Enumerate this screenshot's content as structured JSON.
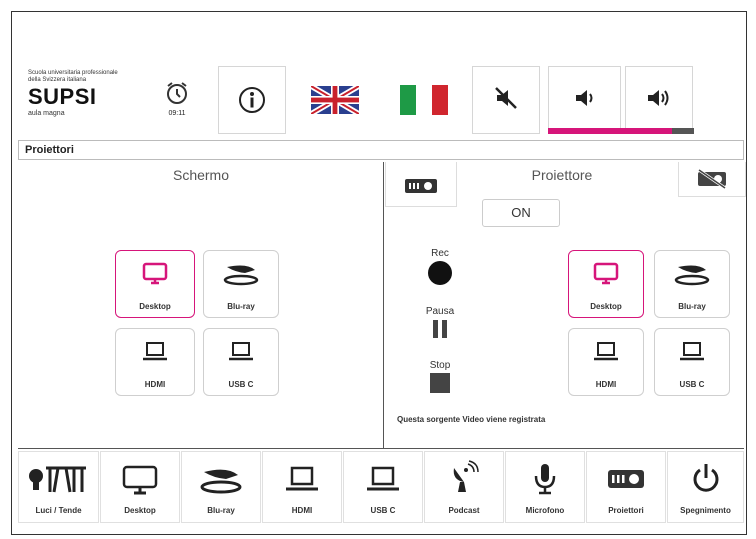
{
  "logo": {
    "line1": "Scuola universitaria professionale",
    "line2": "della Svizzera italiana",
    "name": "SUPSI",
    "subtitle": "aula magna"
  },
  "header": {
    "clock_time": "09:11",
    "volume_level_percent": 85
  },
  "colors": {
    "accent": "#d6157a",
    "flag_it_green": "#1e9a46",
    "flag_it_red": "#d0262e"
  },
  "titlebar": {
    "label": "Proiettori"
  },
  "left": {
    "title": "Schermo",
    "sources": [
      {
        "label": "Desktop",
        "selected": true
      },
      {
        "label": "Blu-ray"
      },
      {
        "label": "HDMI"
      },
      {
        "label": "USB C"
      }
    ]
  },
  "right": {
    "title": "Proiettore",
    "on_label": "ON",
    "rec_label": "Rec",
    "pause_label": "Pausa",
    "stop_label": "Stop",
    "status": "Questa sorgente Video viene registrata",
    "sources": [
      {
        "label": "Desktop",
        "selected": true
      },
      {
        "label": "Blu-ray"
      },
      {
        "label": "HDMI"
      },
      {
        "label": "USB C"
      }
    ]
  },
  "bottom_nav": [
    {
      "label": "Luci / Tende"
    },
    {
      "label": "Desktop"
    },
    {
      "label": "Blu-ray"
    },
    {
      "label": "HDMI"
    },
    {
      "label": "USB C"
    },
    {
      "label": "Podcast"
    },
    {
      "label": "Microfono"
    },
    {
      "label": "Proiettori"
    },
    {
      "label": "Spegnimento"
    }
  ]
}
